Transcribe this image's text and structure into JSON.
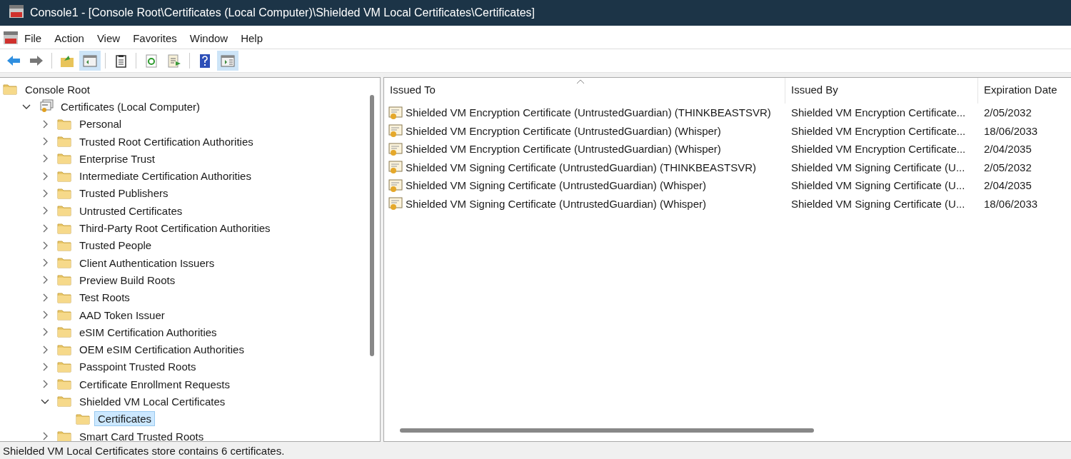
{
  "window": {
    "title": "Console1 - [Console Root\\Certificates (Local Computer)\\Shielded VM Local Certificates\\Certificates]"
  },
  "menu": [
    "File",
    "Action",
    "View",
    "Favorites",
    "Window",
    "Help"
  ],
  "toolbar": [
    {
      "kind": "back",
      "pressed": false
    },
    {
      "kind": "forward",
      "pressed": false
    },
    {
      "kind": "sep"
    },
    {
      "kind": "up",
      "pressed": false
    },
    {
      "kind": "tree",
      "pressed": true
    },
    {
      "kind": "sep"
    },
    {
      "kind": "clipboard",
      "pressed": false
    },
    {
      "kind": "sep"
    },
    {
      "kind": "refresh",
      "pressed": false
    },
    {
      "kind": "export",
      "pressed": false
    },
    {
      "kind": "sep"
    },
    {
      "kind": "help",
      "pressed": false
    },
    {
      "kind": "actionpane",
      "pressed": true
    }
  ],
  "tree": [
    {
      "label": "Console Root",
      "kind": "folder",
      "selected": false,
      "children": [
        {
          "label": "Certificates (Local Computer)",
          "kind": "snapin",
          "expanded": true,
          "selected": false,
          "children": [
            {
              "label": "Personal",
              "kind": "folder",
              "expanded": false,
              "selected": false
            },
            {
              "label": "Trusted Root Certification Authorities",
              "kind": "folder",
              "expanded": false,
              "selected": false
            },
            {
              "label": "Enterprise Trust",
              "kind": "folder",
              "expanded": false,
              "selected": false
            },
            {
              "label": "Intermediate Certification Authorities",
              "kind": "folder",
              "expanded": false,
              "selected": false
            },
            {
              "label": "Trusted Publishers",
              "kind": "folder",
              "expanded": false,
              "selected": false
            },
            {
              "label": "Untrusted Certificates",
              "kind": "folder",
              "expanded": false,
              "selected": false
            },
            {
              "label": "Third-Party Root Certification Authorities",
              "kind": "folder",
              "expanded": false,
              "selected": false
            },
            {
              "label": "Trusted People",
              "kind": "folder",
              "expanded": false,
              "selected": false
            },
            {
              "label": "Client Authentication Issuers",
              "kind": "folder",
              "expanded": false,
              "selected": false
            },
            {
              "label": "Preview Build Roots",
              "kind": "folder",
              "expanded": false,
              "selected": false
            },
            {
              "label": "Test Roots",
              "kind": "folder",
              "expanded": false,
              "selected": false
            },
            {
              "label": "AAD Token Issuer",
              "kind": "folder",
              "expanded": false,
              "selected": false
            },
            {
              "label": "eSIM Certification Authorities",
              "kind": "folder",
              "expanded": false,
              "selected": false
            },
            {
              "label": "OEM eSIM Certification Authorities",
              "kind": "folder",
              "expanded": false,
              "selected": false
            },
            {
              "label": "Passpoint Trusted Roots",
              "kind": "folder",
              "expanded": false,
              "selected": false
            },
            {
              "label": "Certificate Enrollment Requests",
              "kind": "folder",
              "expanded": false,
              "selected": false
            },
            {
              "label": "Shielded VM Local Certificates",
              "kind": "folder",
              "expanded": true,
              "selected": false,
              "children": [
                {
                  "label": "Certificates",
                  "kind": "folder",
                  "selected": true
                }
              ]
            },
            {
              "label": "Smart Card Trusted Roots",
              "kind": "folder",
              "expanded": false,
              "selected": false
            }
          ]
        }
      ]
    }
  ],
  "table": {
    "columns": [
      {
        "label": "Issued To",
        "sorted": true
      },
      {
        "label": "Issued By",
        "sorted": false
      },
      {
        "label": "Expiration Date",
        "sorted": false
      }
    ],
    "rows": [
      [
        "Shielded VM Encryption Certificate (UntrustedGuardian) (THINKBEASTSVR)",
        "Shielded VM Encryption Certificate...",
        "2/05/2032"
      ],
      [
        "Shielded VM Encryption Certificate (UntrustedGuardian) (Whisper)",
        "Shielded VM Encryption Certificate...",
        "18/06/2033"
      ],
      [
        "Shielded VM Encryption Certificate (UntrustedGuardian) (Whisper)",
        "Shielded VM Encryption Certificate...",
        "2/04/2035"
      ],
      [
        "Shielded VM Signing Certificate (UntrustedGuardian) (THINKBEASTSVR)",
        "Shielded VM Signing Certificate (U...",
        "2/05/2032"
      ],
      [
        "Shielded VM Signing Certificate (UntrustedGuardian) (Whisper)",
        "Shielded VM Signing Certificate (U...",
        "2/04/2035"
      ],
      [
        "Shielded VM Signing Certificate (UntrustedGuardian) (Whisper)",
        "Shielded VM Signing Certificate (U...",
        "18/06/2033"
      ]
    ]
  },
  "status_bar": "Shielded VM Local Certificates store contains 6 certificates."
}
